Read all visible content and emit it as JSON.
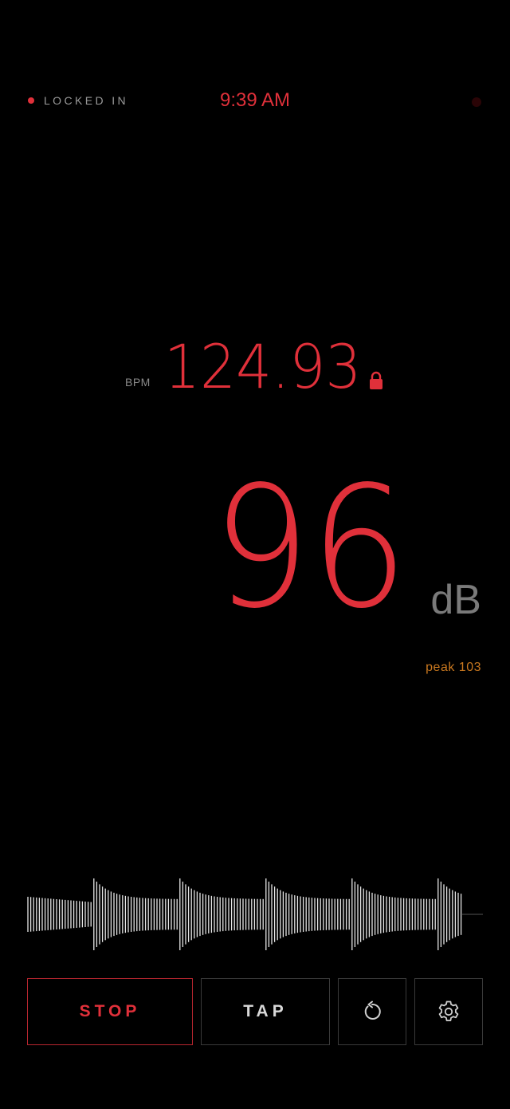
{
  "status": {
    "mode_label": "LOCKED IN",
    "clock": "9:39 AM"
  },
  "bpm": {
    "label": "BPM",
    "value": "124.93",
    "locked": true
  },
  "level": {
    "value": "96",
    "unit": "dB",
    "peak_label": "peak 103"
  },
  "controls": {
    "stop_label": "STOP",
    "tap_label": "TAP"
  },
  "icons": {
    "lock": "lock-icon",
    "reset": "reset-icon",
    "settings": "gear-icon"
  },
  "colors": {
    "accent": "#e0303a",
    "peak": "#c9781f",
    "muted": "#8a8a8a",
    "background": "#000000"
  }
}
